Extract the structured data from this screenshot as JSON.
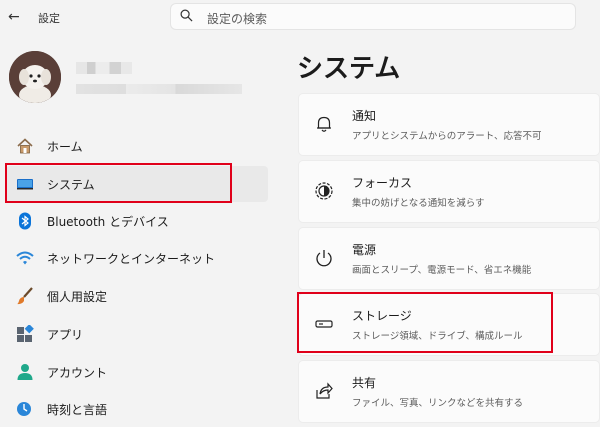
{
  "window": {
    "back_icon": "arrow-left-icon",
    "title": "設定"
  },
  "search": {
    "icon": "search-icon",
    "placeholder": "設定の検索"
  },
  "user": {
    "avatar": "avatar-photo"
  },
  "sidebar": {
    "items": [
      {
        "label": "ホーム",
        "icon": "home-icon"
      },
      {
        "label": "システム",
        "icon": "system-icon",
        "selected": true
      },
      {
        "label": "Bluetooth とデバイス",
        "icon": "bluetooth-icon"
      },
      {
        "label": "ネットワークとインターネット",
        "icon": "wifi-icon"
      },
      {
        "label": "個人用設定",
        "icon": "brush-icon"
      },
      {
        "label": "アプリ",
        "icon": "apps-icon"
      },
      {
        "label": "アカウント",
        "icon": "account-icon"
      },
      {
        "label": "時刻と言語",
        "icon": "time-language-icon"
      }
    ]
  },
  "main": {
    "title": "システム",
    "cards": [
      {
        "title": "通知",
        "subtitle": "アプリとシステムからのアラート、応答不可",
        "icon": "bell-icon"
      },
      {
        "title": "フォーカス",
        "subtitle": "集中の妨げとなる通知を減らす",
        "icon": "focus-icon"
      },
      {
        "title": "電源",
        "subtitle": "画面とスリープ、電源モード、省エネ機能",
        "icon": "power-icon"
      },
      {
        "title": "ストレージ",
        "subtitle": "ストレージ領域、ドライブ、構成ルール",
        "icon": "storage-icon",
        "highlighted": true
      },
      {
        "title": "共有",
        "subtitle": "ファイル、写真、リンクなどを共有する",
        "icon": "share-icon"
      }
    ]
  },
  "colors": {
    "highlight": "#e0001a",
    "accent": "#0067c0",
    "background": "#f3f3f3"
  }
}
